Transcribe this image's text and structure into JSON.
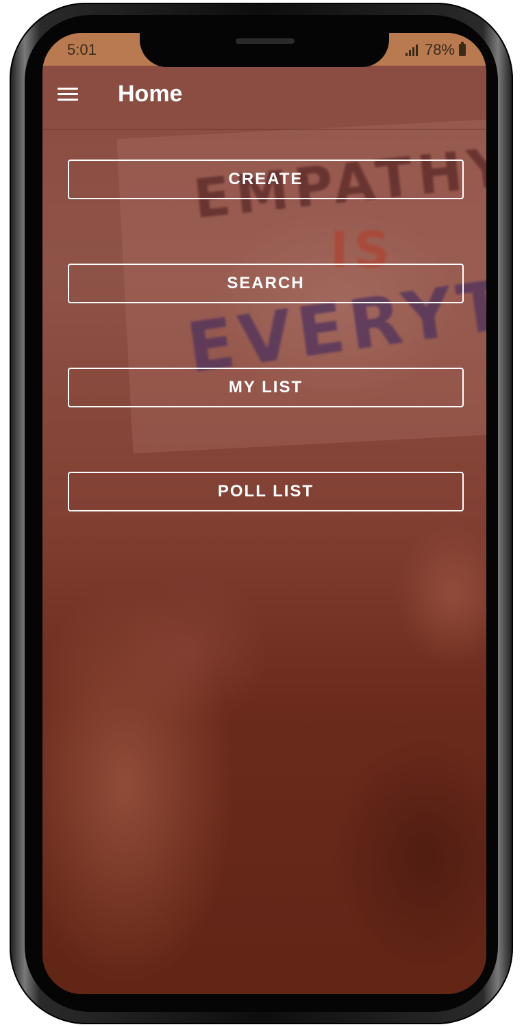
{
  "status_bar": {
    "time": "5:01",
    "battery": "78%"
  },
  "app_bar": {
    "title": "Home",
    "menu_icon": "hamburger-menu-icon"
  },
  "background": {
    "sign_words": [
      "EMPATHY",
      "IS",
      "EVERYT"
    ]
  },
  "buttons": {
    "create": "CREATE",
    "search": "SEARCH",
    "my_list": "MY LIST",
    "poll_list": "POLL LIST"
  },
  "colors": {
    "status_bar": "#b87a4e",
    "button_border": "#ffffff",
    "text": "#ffffff"
  }
}
